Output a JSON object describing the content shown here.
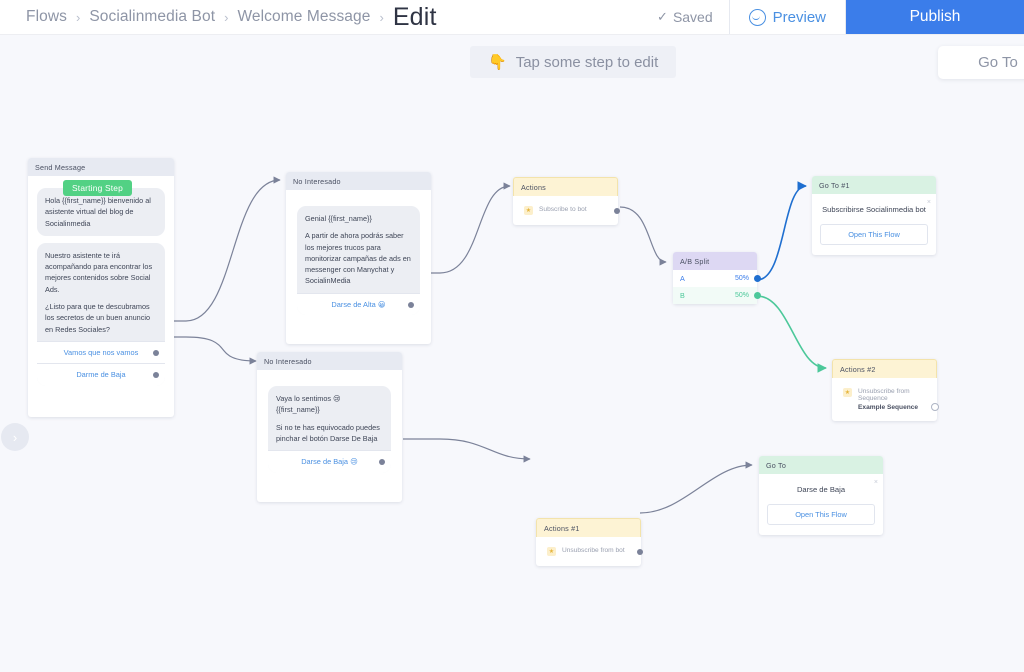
{
  "topbar": {
    "breadcrumb": [
      "Flows",
      "Socialinmedia Bot",
      "Welcome Message",
      "Edit"
    ],
    "separator": "›",
    "saved_label": "Saved",
    "saved_icon": "✓",
    "preview_label": "Preview",
    "preview_icon": "messenger-icon",
    "publish_label": "Publish"
  },
  "canvas": {
    "hint": {
      "icon": "👇",
      "text": "Tap some step to edit"
    },
    "goto_panel_label": "Go To",
    "left_nav_icon": "›",
    "starting_badge": "Starting Step",
    "colors": {
      "accent_blue": "#3b7dea",
      "branch_a": "#1f6fd0",
      "branch_b": "#4cc89a",
      "edge": "#7b8299",
      "green_badge": "#52d184",
      "yellow_head": "#fdf3d4",
      "purple_head": "#ddd8f3",
      "green_head": "#d9f2e3",
      "gray_head": "#e7eaf2"
    }
  },
  "nodes": {
    "send_message": {
      "title": "Send Message",
      "bubble1": "Hola {{first_name}} bienvenido al asistente virtual del blog de Socialinmedia",
      "bubble2_p1": "Nuestro asistente te irá acompañando para encontrar los mejores contenidos sobre Social Ads.",
      "bubble2_p2": "¿Listo para que te descubramos los secretos de un buen anuncio en Redes Sociales?",
      "button1": "Vamos que nos vamos",
      "button2": "Darme de Baja"
    },
    "no_interesado_1": {
      "title": "No Interesado",
      "text_p1": "Genial  {{first_name}}",
      "text_p2": "A partir de ahora podrás saber los mejores trucos para monitorizar campañas de ads en messenger con Manychat y SocialinMedia",
      "button1": "Darse de Alta 😀"
    },
    "no_interesado_2": {
      "title": "No Interesado",
      "text_p1": "Vaya lo sentimos 😢 {{first_name}}",
      "text_p2": "Si no te has equivocado puedes pinchar el botón Darse De Baja",
      "button1": "Darse de Baja 😢"
    },
    "actions": {
      "title": "Actions",
      "row1": "Subscribe to bot"
    },
    "actions_1": {
      "title": "Actions #1",
      "row1": "Unsubscribe from bot"
    },
    "actions_2": {
      "title": "Actions #2",
      "row1": "Unsubscribe from Sequence",
      "row1_sub": "Example Sequence"
    },
    "ab_split": {
      "title": "A/B Split",
      "branch_a_label": "A",
      "branch_a_pct": "50%",
      "branch_b_label": "B",
      "branch_b_pct": "50%"
    },
    "goto_1": {
      "title": "Go To #1",
      "target": "Subscribirse Socialinmedia bot",
      "button": "Open This Flow",
      "close": "×"
    },
    "goto_2": {
      "title": "Go To",
      "target": "Darse de Baja",
      "button": "Open This Flow",
      "close": "×"
    }
  }
}
